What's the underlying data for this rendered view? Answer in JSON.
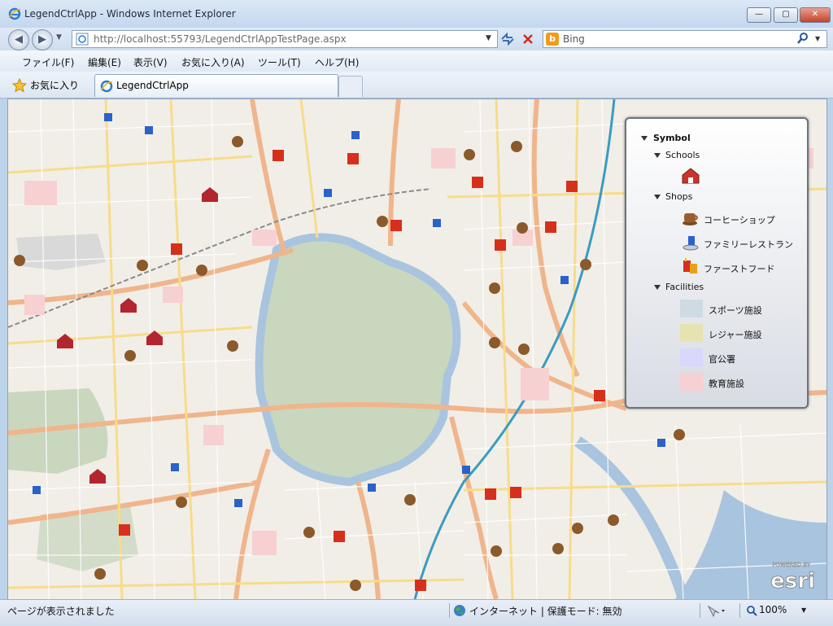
{
  "window": {
    "title": "LegendCtrlApp - Windows Internet Explorer",
    "minimize": "—",
    "maximize": "▢",
    "close": "✕"
  },
  "nav": {
    "address": "http://localhost:55793/LegendCtrlAppTestPage.aspx",
    "search_engine": "Bing",
    "search_placeholder": ""
  },
  "menu": [
    "ファイル(F)",
    "編集(E)",
    "表示(V)",
    "お気に入り(A)",
    "ツール(T)",
    "ヘルプ(H)"
  ],
  "favorites": {
    "label": "お気に入り",
    "tab_title": "LegendCtrlApp"
  },
  "legend": {
    "root": "Symbol",
    "groups": [
      {
        "name": "Schools",
        "items": []
      },
      {
        "name": "Shops",
        "items": [
          "コーヒーショップ",
          "ファミリーレストラン",
          "ファーストフード"
        ]
      },
      {
        "name": "Facilities",
        "items": [
          "スポーツ施設",
          "レジャー施設",
          "官公署",
          "教育施設"
        ]
      }
    ],
    "facility_colors": [
      "#cfdbe3",
      "#e6e3b1",
      "#d9d7fb",
      "#f7d0d2"
    ]
  },
  "map": {
    "brand": "esri",
    "brand_tag": "POWERED BY"
  },
  "status": {
    "left": "ページが表示されました",
    "zone": "インターネット | 保護モード: 無効",
    "zoom": "100%"
  },
  "colors": {
    "park": "#c9d7bf",
    "water": "#a9c4de",
    "major_road": "#f0b58b",
    "secondary_road": "#f7dc8a",
    "rail": "#3a9cc0"
  }
}
